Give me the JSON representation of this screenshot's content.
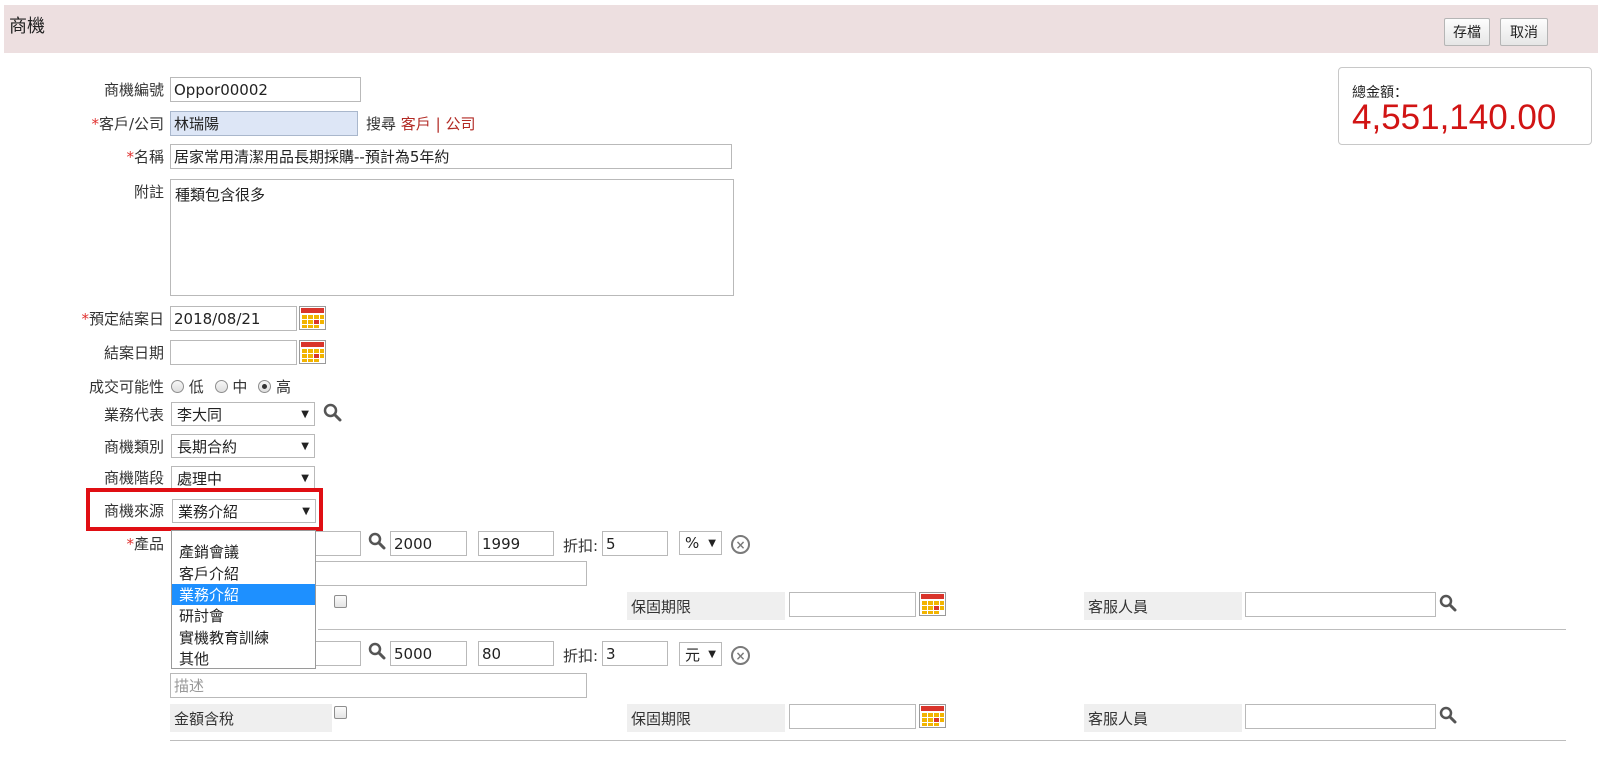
{
  "header": {
    "title": "商機",
    "save_label": "存檔",
    "cancel_label": "取消"
  },
  "total": {
    "label": "總金額：",
    "value": "4,551,140.00"
  },
  "form": {
    "opp_no": {
      "label": "商機編號",
      "value": "Oppor00002"
    },
    "customer": {
      "label": "客戶/公司",
      "required": "*",
      "value": "林瑞陽",
      "search_label": "搜尋",
      "link_customer": "客戶",
      "separator": "|",
      "link_company": "公司"
    },
    "name": {
      "label": "名稱",
      "required": "*",
      "value": "居家常用清潔用品長期採購--預計為5年約"
    },
    "note": {
      "label": "附註",
      "value": "種類包含很多"
    },
    "expected_close": {
      "label": "預定結案日",
      "required": "*",
      "value": "2018/08/21"
    },
    "close_date": {
      "label": "結案日期",
      "value": ""
    },
    "probability": {
      "label": "成交可能性",
      "options": [
        "低",
        "中",
        "高"
      ],
      "selected": "高"
    },
    "rep": {
      "label": "業務代表",
      "value": "李大同"
    },
    "category": {
      "label": "商機類別",
      "value": "長期合約"
    },
    "stage": {
      "label": "商機階段",
      "value": "處理中"
    },
    "source": {
      "label": "商機來源",
      "value": "業務介紹",
      "options": [
        "產銷會議",
        "客戶介紹",
        "業務介紹",
        "研討會",
        "實機教育訓練",
        "其他"
      ],
      "selected": "業務介紹"
    },
    "product": {
      "label": "產品",
      "required": "*"
    }
  },
  "products": [
    {
      "price": "2000",
      "qty": "1999",
      "discount_label": "折扣:",
      "discount": "5",
      "unit": "%",
      "desc_placeholder": "描述",
      "tax_label": "金額含稅",
      "warranty_label": "保固期限",
      "service_label": "客服人員"
    },
    {
      "price": "5000",
      "qty": "80",
      "discount_label": "折扣:",
      "discount": "3",
      "unit": "元",
      "desc_placeholder": "描述",
      "tax_label": "金額含稅",
      "warranty_label": "保固期限",
      "service_label": "客服人員"
    }
  ],
  "icons": {
    "close": "×",
    "dropdown": "▼"
  },
  "colors": {
    "header_bg": "#eddfe0",
    "total": "#d11414",
    "required": "#e0312f",
    "link": "#b22a24",
    "highlight": "#e00e13",
    "selected_option": "#1e90ff"
  }
}
